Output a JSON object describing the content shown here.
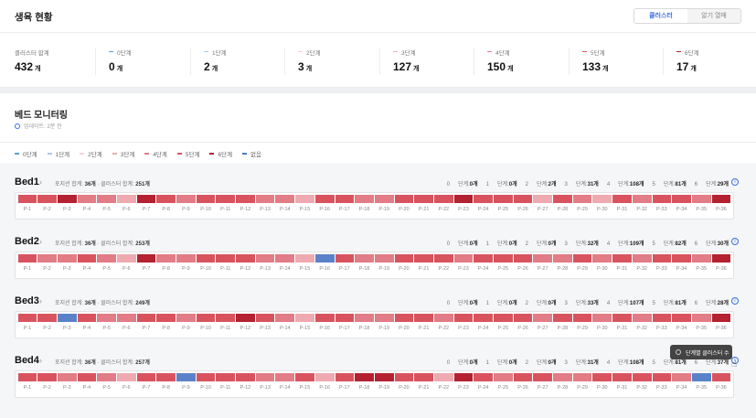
{
  "header": {
    "title": "생육 현황",
    "seg": [
      "클러스터",
      "알기 열매"
    ]
  },
  "stats": [
    {
      "label": "클러스터 합계",
      "value": "432",
      "unit": "개",
      "color": ""
    },
    {
      "label": "0단계",
      "value": "0",
      "unit": "개",
      "color": "#5aa0d9"
    },
    {
      "label": "1단계",
      "value": "2",
      "unit": "개",
      "color": "#a9c7e6"
    },
    {
      "label": "2단계",
      "value": "3",
      "unit": "개",
      "color": "#f2d4d8"
    },
    {
      "label": "3단계",
      "value": "127",
      "unit": "개",
      "color": "#eeaab0"
    },
    {
      "label": "4단계",
      "value": "150",
      "unit": "개",
      "color": "#e27c86"
    },
    {
      "label": "5단계",
      "value": "133",
      "unit": "개",
      "color": "#d9535f"
    },
    {
      "label": "6단계",
      "value": "17",
      "unit": "개",
      "color": "#b42130"
    }
  ],
  "monitor": {
    "title": "베드 모니터링",
    "updated": "업데이트: 2분 전"
  },
  "legend": [
    {
      "label": "0단계",
      "color": "#5aa0d9"
    },
    {
      "label": "1단계",
      "color": "#a9c7e6"
    },
    {
      "label": "2단계",
      "color": "#f2d4d8"
    },
    {
      "label": "3단계",
      "color": "#eeaab0"
    },
    {
      "label": "4단계",
      "color": "#e27c86"
    },
    {
      "label": "5단계",
      "color": "#d9535f"
    },
    {
      "label": "6단계",
      "color": "#b42130"
    },
    {
      "label": "없음",
      "color": "#4f7cc8"
    }
  ],
  "stage_colors": [
    "#5aa0d9",
    "#a9c7e6",
    "#f2d4d8",
    "#eeaab0",
    "#e27c86",
    "#d9535f",
    "#b42130",
    "#5b82c9"
  ],
  "beds": [
    {
      "name": "Bed1",
      "pods_total": "36",
      "cluster_total": "251",
      "counts": [
        "0",
        "0",
        "2",
        "31",
        "108",
        "81",
        "29"
      ],
      "pods": [
        5,
        5,
        6,
        4,
        4,
        3,
        6,
        5,
        4,
        5,
        5,
        5,
        4,
        4,
        3,
        5,
        5,
        4,
        4,
        5,
        5,
        5,
        6,
        5,
        5,
        5,
        3,
        5,
        4,
        3,
        5,
        4,
        5,
        5,
        4,
        6
      ]
    },
    {
      "name": "Bed2",
      "pods_total": "36",
      "cluster_total": "253",
      "counts": [
        "0",
        "0",
        "0",
        "32",
        "109",
        "82",
        "30"
      ],
      "pods": [
        5,
        4,
        4,
        5,
        4,
        3,
        6,
        4,
        4,
        5,
        5,
        5,
        4,
        4,
        3,
        7,
        5,
        4,
        4,
        5,
        5,
        5,
        4,
        5,
        5,
        5,
        4,
        4,
        5,
        4,
        5,
        4,
        5,
        5,
        4,
        6
      ]
    },
    {
      "name": "Bed3",
      "pods_total": "36",
      "cluster_total": "249",
      "counts": [
        "0",
        "0",
        "0",
        "33",
        "107",
        "81",
        "28"
      ],
      "pods": [
        5,
        5,
        7,
        5,
        4,
        4,
        5,
        5,
        4,
        5,
        5,
        6,
        5,
        4,
        3,
        5,
        5,
        4,
        4,
        5,
        5,
        4,
        5,
        5,
        5,
        5,
        4,
        5,
        5,
        4,
        5,
        4,
        5,
        5,
        4,
        6
      ]
    },
    {
      "name": "Bed4",
      "pods_total": "36",
      "cluster_total": "257",
      "counts": [
        "0",
        "0",
        "0",
        "31",
        "108",
        "81",
        "37"
      ],
      "pods": [
        5,
        5,
        4,
        5,
        4,
        3,
        5,
        5,
        7,
        5,
        5,
        5,
        4,
        4,
        5,
        3,
        5,
        6,
        6,
        5,
        5,
        3,
        6,
        5,
        4,
        5,
        5,
        4,
        4,
        5,
        5,
        5,
        5,
        4,
        7,
        5
      ]
    }
  ],
  "labels": {
    "pods_total_label": "포지션 합계:",
    "cluster_total_label": "· 클러스터 합계:",
    "unit": "개",
    "stage_suffix": "단계:"
  },
  "tooltip": "단계별 클러스터 수"
}
